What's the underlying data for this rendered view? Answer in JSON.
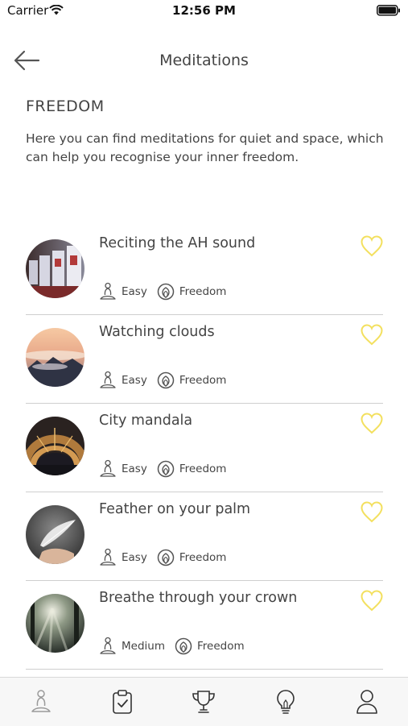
{
  "status": {
    "carrier": "Carrier",
    "time": "12:56 PM"
  },
  "header": {
    "title": "Meditations"
  },
  "section": {
    "title": "FREEDOM",
    "description": "Here you can find meditations for quiet and space, which can help you recognise your inner freedom."
  },
  "meditations": [
    {
      "title": "Reciting the AH sound",
      "level": "Easy",
      "category": "Freedom"
    },
    {
      "title": "Watching clouds",
      "level": "Easy",
      "category": "Freedom"
    },
    {
      "title": "City mandala",
      "level": "Easy",
      "category": "Freedom"
    },
    {
      "title": "Feather on your palm",
      "level": "Easy",
      "category": "Freedom"
    },
    {
      "title": "Breathe through your crown",
      "level": "Medium",
      "category": "Freedom"
    }
  ],
  "colors": {
    "heart": "#f3e05f",
    "text": "#444444",
    "divider": "#cfcfcf",
    "tab_bar": "#f7f7f7"
  },
  "icons": {
    "tabs": [
      "meditator-icon",
      "clipboard-check-icon",
      "trophy-icon",
      "lightbulb-icon",
      "user-icon"
    ],
    "item": [
      "heart-icon",
      "meditator-icon",
      "lotus-icon"
    ]
  }
}
